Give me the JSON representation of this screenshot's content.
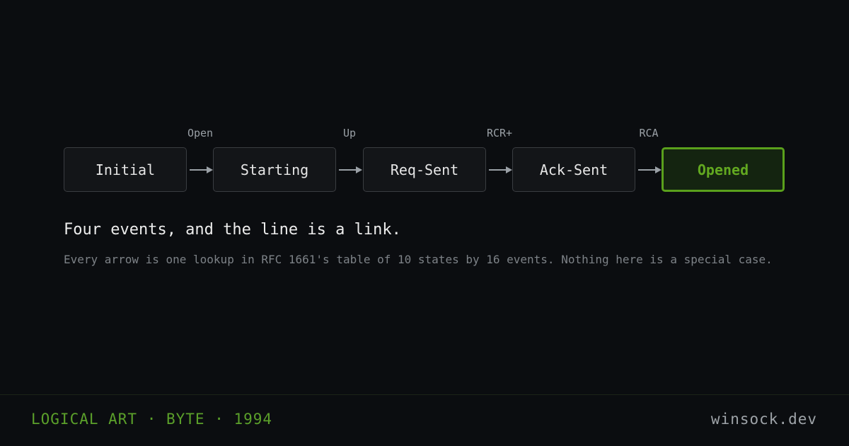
{
  "diagram": {
    "states": [
      "Initial",
      "Starting",
      "Req-Sent",
      "Ack-Sent",
      "Opened"
    ],
    "events": [
      "Open",
      "Up",
      "RCR+",
      "RCA"
    ],
    "final_state_color": "#5aa01c",
    "arrow_color": "#9aa0a6"
  },
  "headline": "Four events, and the line is a link.",
  "subline": "Every arrow is one lookup in RFC 1661's table of 10 states by 16 events. Nothing here is a special case.",
  "footer": {
    "left": "LOGICAL ART · BYTE · 1994",
    "right": "winsock.dev"
  }
}
